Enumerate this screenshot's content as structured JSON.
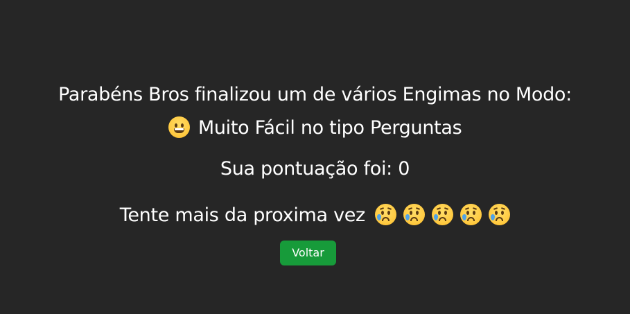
{
  "result": {
    "line1": "Parabéns Bros finalizou um de vários Engimas no Modo:",
    "mode_text": "Muito Fácil no tipo Perguntas",
    "mode_icon": "grinning-face-icon",
    "score_label": "Sua pontuação foi: 0",
    "message": "Tente mais da proxima vez",
    "message_icons": [
      "sad-tear-face-icon",
      "sad-tear-face-icon",
      "sad-tear-face-icon",
      "sad-tear-face-icon",
      "sad-tear-face-icon"
    ]
  },
  "actions": {
    "back_label": "Voltar"
  },
  "colors": {
    "background": "#262626",
    "text": "#ffffff",
    "button": "#179b3a"
  }
}
